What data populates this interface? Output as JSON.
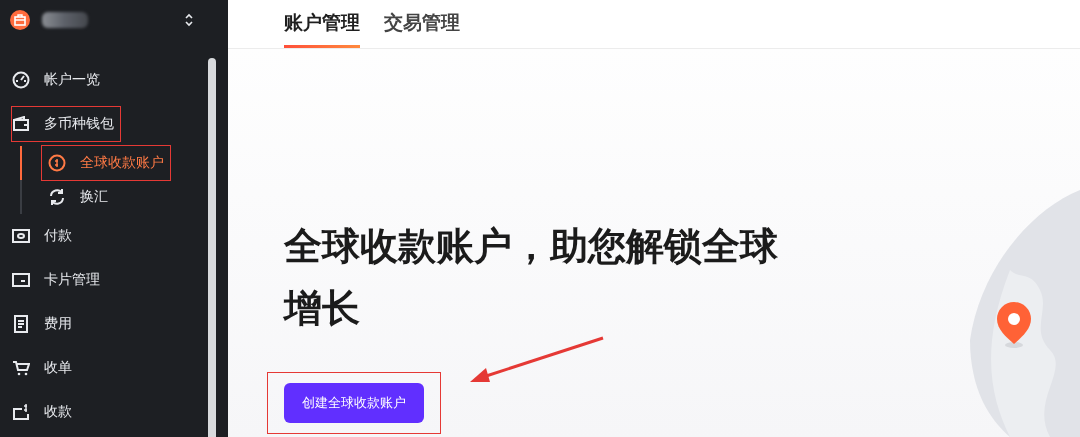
{
  "sidebar": {
    "items": [
      {
        "label": "帐户一览",
        "selected": false,
        "highlighted": false
      },
      {
        "label": "多币种钱包",
        "selected": false,
        "highlighted": true,
        "expanded": true,
        "children": [
          {
            "label": "全球收款账户",
            "selected": true,
            "highlighted": true
          },
          {
            "label": "换汇",
            "selected": false,
            "highlighted": false
          }
        ]
      },
      {
        "label": "付款",
        "selected": false,
        "highlighted": false
      },
      {
        "label": "卡片管理",
        "selected": false,
        "highlighted": false
      },
      {
        "label": "费用",
        "selected": false,
        "highlighted": false
      },
      {
        "label": "收单",
        "selected": false,
        "highlighted": false
      },
      {
        "label": "收款",
        "selected": false,
        "highlighted": false
      }
    ]
  },
  "tabs": [
    {
      "label": "账户管理",
      "selected": true
    },
    {
      "label": "交易管理",
      "selected": false
    }
  ],
  "hero": {
    "title": "全球收款账户，助您解锁全球增长",
    "button": {
      "label": "创建全球收款账户",
      "highlighted": true
    }
  }
}
